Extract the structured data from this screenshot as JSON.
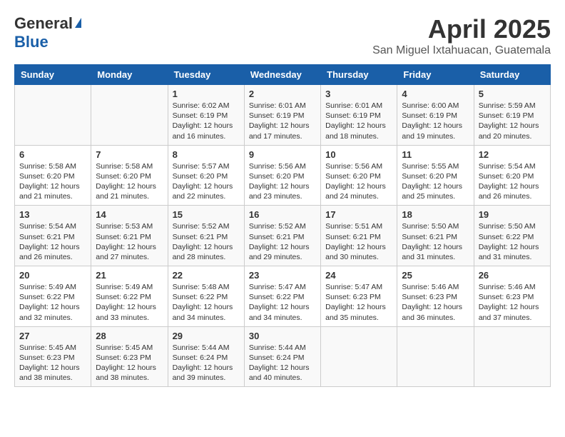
{
  "logo": {
    "general": "General",
    "blue": "Blue"
  },
  "title": "April 2025",
  "subtitle": "San Miguel Ixtahuacan, Guatemala",
  "days": [
    "Sunday",
    "Monday",
    "Tuesday",
    "Wednesday",
    "Thursday",
    "Friday",
    "Saturday"
  ],
  "weeks": [
    [
      {
        "day": "",
        "info": ""
      },
      {
        "day": "",
        "info": ""
      },
      {
        "day": "1",
        "info": "Sunrise: 6:02 AM\nSunset: 6:19 PM\nDaylight: 12 hours and 16 minutes."
      },
      {
        "day": "2",
        "info": "Sunrise: 6:01 AM\nSunset: 6:19 PM\nDaylight: 12 hours and 17 minutes."
      },
      {
        "day": "3",
        "info": "Sunrise: 6:01 AM\nSunset: 6:19 PM\nDaylight: 12 hours and 18 minutes."
      },
      {
        "day": "4",
        "info": "Sunrise: 6:00 AM\nSunset: 6:19 PM\nDaylight: 12 hours and 19 minutes."
      },
      {
        "day": "5",
        "info": "Sunrise: 5:59 AM\nSunset: 6:19 PM\nDaylight: 12 hours and 20 minutes."
      }
    ],
    [
      {
        "day": "6",
        "info": "Sunrise: 5:58 AM\nSunset: 6:20 PM\nDaylight: 12 hours and 21 minutes."
      },
      {
        "day": "7",
        "info": "Sunrise: 5:58 AM\nSunset: 6:20 PM\nDaylight: 12 hours and 21 minutes."
      },
      {
        "day": "8",
        "info": "Sunrise: 5:57 AM\nSunset: 6:20 PM\nDaylight: 12 hours and 22 minutes."
      },
      {
        "day": "9",
        "info": "Sunrise: 5:56 AM\nSunset: 6:20 PM\nDaylight: 12 hours and 23 minutes."
      },
      {
        "day": "10",
        "info": "Sunrise: 5:56 AM\nSunset: 6:20 PM\nDaylight: 12 hours and 24 minutes."
      },
      {
        "day": "11",
        "info": "Sunrise: 5:55 AM\nSunset: 6:20 PM\nDaylight: 12 hours and 25 minutes."
      },
      {
        "day": "12",
        "info": "Sunrise: 5:54 AM\nSunset: 6:20 PM\nDaylight: 12 hours and 26 minutes."
      }
    ],
    [
      {
        "day": "13",
        "info": "Sunrise: 5:54 AM\nSunset: 6:21 PM\nDaylight: 12 hours and 26 minutes."
      },
      {
        "day": "14",
        "info": "Sunrise: 5:53 AM\nSunset: 6:21 PM\nDaylight: 12 hours and 27 minutes."
      },
      {
        "day": "15",
        "info": "Sunrise: 5:52 AM\nSunset: 6:21 PM\nDaylight: 12 hours and 28 minutes."
      },
      {
        "day": "16",
        "info": "Sunrise: 5:52 AM\nSunset: 6:21 PM\nDaylight: 12 hours and 29 minutes."
      },
      {
        "day": "17",
        "info": "Sunrise: 5:51 AM\nSunset: 6:21 PM\nDaylight: 12 hours and 30 minutes."
      },
      {
        "day": "18",
        "info": "Sunrise: 5:50 AM\nSunset: 6:21 PM\nDaylight: 12 hours and 31 minutes."
      },
      {
        "day": "19",
        "info": "Sunrise: 5:50 AM\nSunset: 6:22 PM\nDaylight: 12 hours and 31 minutes."
      }
    ],
    [
      {
        "day": "20",
        "info": "Sunrise: 5:49 AM\nSunset: 6:22 PM\nDaylight: 12 hours and 32 minutes."
      },
      {
        "day": "21",
        "info": "Sunrise: 5:49 AM\nSunset: 6:22 PM\nDaylight: 12 hours and 33 minutes."
      },
      {
        "day": "22",
        "info": "Sunrise: 5:48 AM\nSunset: 6:22 PM\nDaylight: 12 hours and 34 minutes."
      },
      {
        "day": "23",
        "info": "Sunrise: 5:47 AM\nSunset: 6:22 PM\nDaylight: 12 hours and 34 minutes."
      },
      {
        "day": "24",
        "info": "Sunrise: 5:47 AM\nSunset: 6:23 PM\nDaylight: 12 hours and 35 minutes."
      },
      {
        "day": "25",
        "info": "Sunrise: 5:46 AM\nSunset: 6:23 PM\nDaylight: 12 hours and 36 minutes."
      },
      {
        "day": "26",
        "info": "Sunrise: 5:46 AM\nSunset: 6:23 PM\nDaylight: 12 hours and 37 minutes."
      }
    ],
    [
      {
        "day": "27",
        "info": "Sunrise: 5:45 AM\nSunset: 6:23 PM\nDaylight: 12 hours and 38 minutes."
      },
      {
        "day": "28",
        "info": "Sunrise: 5:45 AM\nSunset: 6:23 PM\nDaylight: 12 hours and 38 minutes."
      },
      {
        "day": "29",
        "info": "Sunrise: 5:44 AM\nSunset: 6:24 PM\nDaylight: 12 hours and 39 minutes."
      },
      {
        "day": "30",
        "info": "Sunrise: 5:44 AM\nSunset: 6:24 PM\nDaylight: 12 hours and 40 minutes."
      },
      {
        "day": "",
        "info": ""
      },
      {
        "day": "",
        "info": ""
      },
      {
        "day": "",
        "info": ""
      }
    ]
  ]
}
